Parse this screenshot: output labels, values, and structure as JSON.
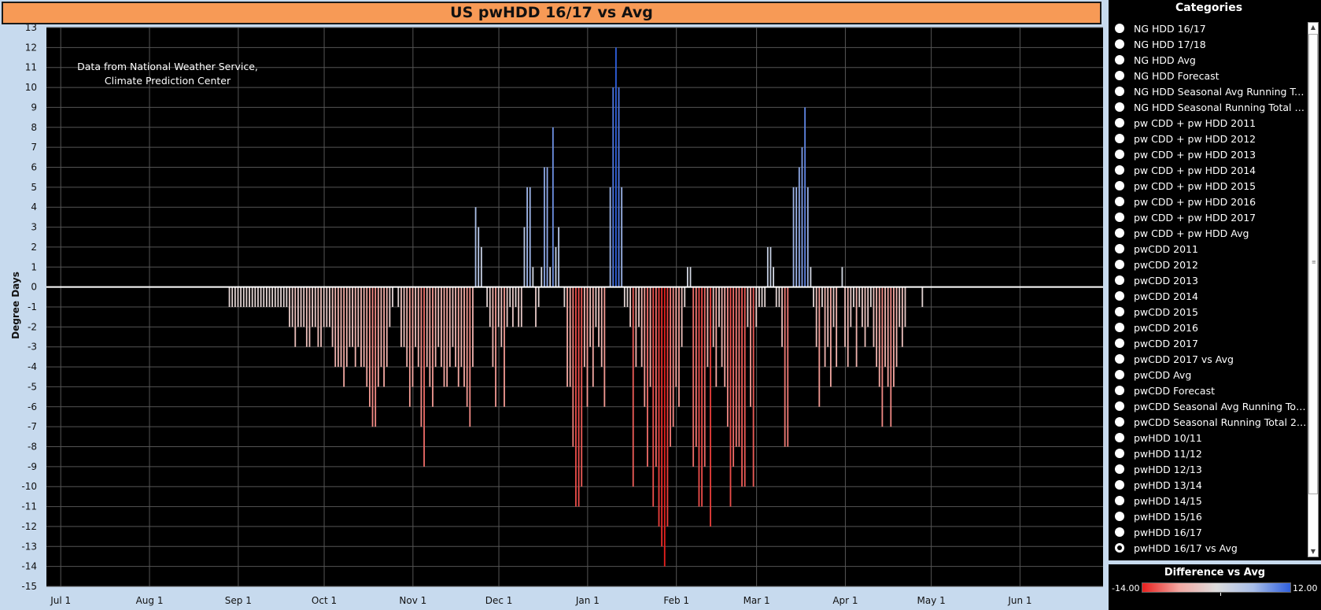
{
  "title": "US pwHDD 16/17 vs Avg",
  "sidebar": {
    "title": "Categories",
    "items": [
      "NG HDD 16/17",
      "NG HDD 17/18",
      "NG HDD Avg",
      "NG HDD Forecast",
      "NG HDD Seasonal Avg Running To...",
      "NG HDD Seasonal Running Total 1...",
      "pw CDD + pw HDD 2011",
      "pw CDD + pw HDD 2012",
      "pw CDD + pw HDD 2013",
      "pw CDD + pw HDD 2014",
      "pw CDD + pw HDD 2015",
      "pw CDD + pw HDD 2016",
      "pw CDD + pw HDD 2017",
      "pw CDD + pw HDD Avg",
      "pwCDD 2011",
      "pwCDD 2012",
      "pwCDD 2013",
      "pwCDD 2014",
      "pwCDD 2015",
      "pwCDD 2016",
      "pwCDD 2017",
      "pwCDD 2017 vs Avg",
      "pwCDD Avg",
      "pwCDD Forecast",
      "pwCDD Seasonal Avg Running Total",
      "pwCDD Seasonal Running Total 20...",
      "pwHDD 10/11",
      "pwHDD 11/12",
      "pwHDD 12/13",
      "pwHDD 13/14",
      "pwHDD 14/15",
      "pwHDD 15/16",
      "pwHDD 16/17",
      "pwHDD 16/17 vs Avg"
    ],
    "selected_index": 33
  },
  "legend": {
    "title": "Difference vs Avg",
    "min_label": "-14.00",
    "max_label": "12.00",
    "colors": [
      "#e8201e",
      "#f2a8a2",
      "#dddddd",
      "#a8bde8",
      "#2f5fdc"
    ]
  },
  "colors": {
    "plot_bg": "#000000",
    "grid": "#555555",
    "page_bg": "#c7daee",
    "title_bg": "#f79a56"
  },
  "chart_data": {
    "type": "bar",
    "title": "US pwHDD 16/17 vs Avg",
    "ylabel": "Degree Days",
    "xlabel": "",
    "annotation": "Data from National Weather Service,\nClimate Prediction Center",
    "ylim": [
      -15,
      13
    ],
    "yticks": [
      13,
      12,
      11,
      10,
      9,
      8,
      7,
      6,
      5,
      4,
      3,
      2,
      1,
      0,
      -1,
      -2,
      -3,
      -4,
      -5,
      -6,
      -7,
      -8,
      -9,
      -10,
      -11,
      -12,
      -13,
      -14,
      -15
    ],
    "x_range": [
      "2016-06-26",
      "2017-06-30"
    ],
    "xticks": [
      {
        "date": "2016-07-01",
        "label": "Jul 1"
      },
      {
        "date": "2016-08-01",
        "label": "Aug 1"
      },
      {
        "date": "2016-09-01",
        "label": "Sep 1"
      },
      {
        "date": "2016-10-01",
        "label": "Oct 1"
      },
      {
        "date": "2016-11-01",
        "label": "Nov 1"
      },
      {
        "date": "2016-12-01",
        "label": "Dec 1"
      },
      {
        "date": "2017-01-01",
        "label": "Jan 1"
      },
      {
        "date": "2017-02-01",
        "label": "Feb 1"
      },
      {
        "date": "2017-03-01",
        "label": "Mar 1"
      },
      {
        "date": "2017-04-01",
        "label": "Apr 1"
      },
      {
        "date": "2017-05-01",
        "label": "May 1"
      },
      {
        "date": "2017-06-01",
        "label": "Jun 1"
      }
    ],
    "series": [
      {
        "start_date": "2016-08-29",
        "values": [
          -1,
          -1,
          -1,
          -1,
          -1,
          -1,
          -1,
          -1,
          -1,
          -1,
          -1,
          -1,
          -1,
          -1,
          -1,
          -1,
          -1,
          -1,
          -1,
          -1,
          -1,
          -2,
          -2,
          -3,
          -2,
          -2,
          -2,
          -3,
          -3,
          -2,
          -2,
          -3,
          -3,
          -2,
          -2,
          -2,
          -3,
          -4,
          -4,
          -4,
          -5,
          -4,
          -3,
          -3,
          -4,
          -3,
          -4,
          -4,
          -5,
          -6,
          -7,
          -7,
          -5,
          -4,
          -5,
          -4,
          -2,
          -1,
          0,
          -1,
          -3,
          -3,
          -4,
          -6,
          -5,
          -3,
          -4,
          -7,
          -9,
          -4,
          -5,
          -6,
          -4,
          -3,
          -4,
          -5,
          -5,
          -4,
          -3,
          -4,
          -5,
          -4,
          -5,
          -6,
          -7,
          -4,
          4,
          3,
          2,
          0,
          -1,
          -2,
          -4,
          -6,
          -2,
          -3,
          -6,
          -2,
          -1,
          -2,
          -1,
          -2,
          -2,
          3,
          5,
          5,
          1,
          -2,
          -1,
          1,
          6,
          6,
          1,
          8,
          2,
          3,
          0,
          -1,
          -5,
          -5,
          -8,
          -11,
          -11,
          -10,
          -4,
          -6,
          -3,
          -5,
          -2,
          -3,
          -4,
          -6,
          0,
          5,
          10,
          12,
          10,
          5,
          -1,
          -1,
          -2,
          -10,
          -4,
          -2,
          -4,
          -6,
          -9,
          -5,
          -11,
          -9,
          -12,
          -13,
          -14,
          -12,
          -8,
          -7,
          -5,
          -6,
          -3,
          -1,
          1,
          1,
          -9,
          -8,
          -11,
          -11,
          -9,
          -4,
          -12,
          -3,
          -5,
          -2,
          -4,
          -5,
          -7,
          -11,
          -9,
          -8,
          -8,
          -10,
          -10,
          -2,
          -6,
          -10,
          -2,
          -1,
          -1,
          -1,
          2,
          2,
          1,
          -1,
          -1,
          -3,
          -8,
          -8,
          0,
          5,
          5,
          6,
          7,
          9,
          5,
          1,
          -1,
          -3,
          -6,
          -1,
          -4,
          -3,
          -5,
          -2,
          -4,
          0,
          1,
          -3,
          -4,
          -2,
          -1,
          -4,
          -1,
          -2,
          -3,
          -2,
          -1,
          -3,
          -4,
          -5,
          -7,
          -4,
          -5,
          -7,
          -5,
          -4,
          -2,
          -3,
          -2,
          0,
          0,
          0,
          0,
          0,
          -1
        ]
      }
    ]
  }
}
